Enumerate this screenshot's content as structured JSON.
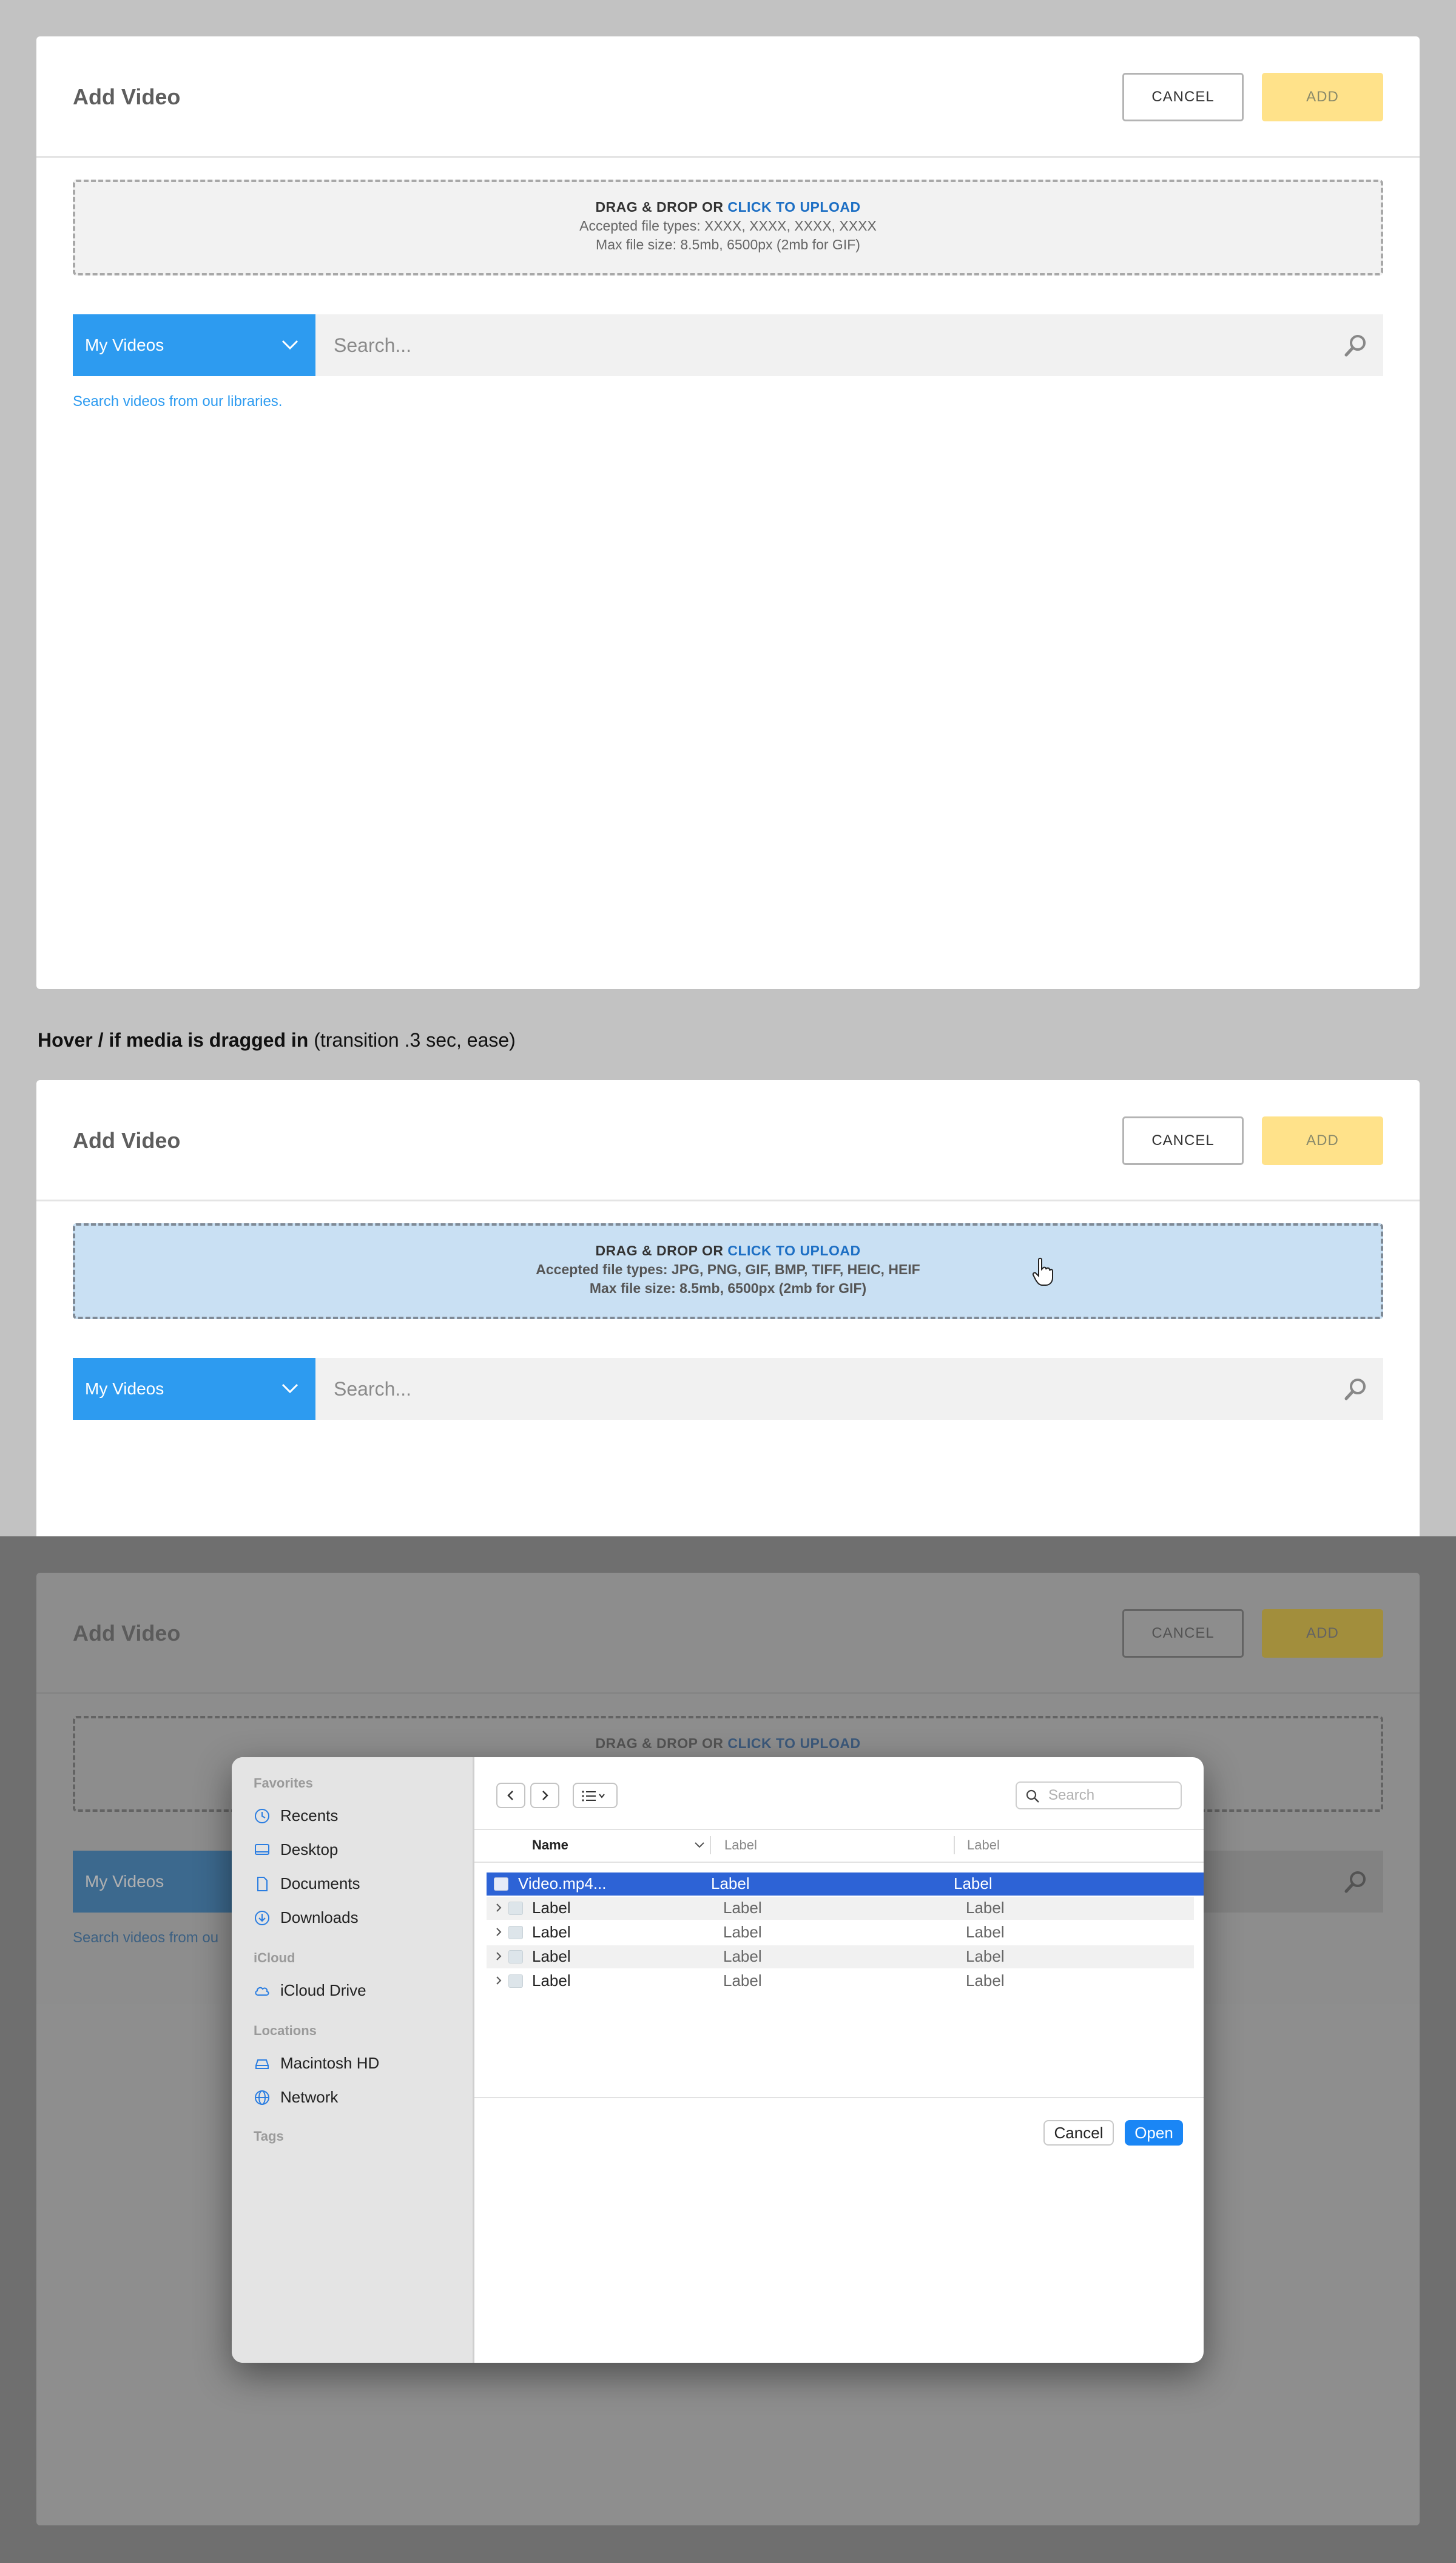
{
  "modal": {
    "title": "Add Video",
    "cancel_label": "CANCEL",
    "add_label": "ADD",
    "dropzone": {
      "prefix": "DRAG & DROP OR",
      "link": "CLICK TO UPLOAD",
      "accepted": "Accepted file types: XXXX, XXXX, XXXX, XXXX",
      "accepted_hover": "Accepted file types: JPG, PNG, GIF, BMP, TIFF, HEIC, HEIF",
      "max_size": "Max file size: 8.5mb, 6500px  (2mb for GIF)"
    },
    "library_select": "My Videos",
    "search_placeholder": "Search...",
    "helper_text": "Search videos from our libraries.",
    "helper_text_truncated": "Search videos from ou"
  },
  "annotation": {
    "bold": "Hover / if media is dragged in",
    "rest": " (transition .3 sec, ease)"
  },
  "file_dialog": {
    "sidebar": {
      "favorites_heading": "Favorites",
      "favorites": [
        {
          "label": "Recents",
          "icon": "clock-icon"
        },
        {
          "label": "Desktop",
          "icon": "desktop-icon"
        },
        {
          "label": "Documents",
          "icon": "document-icon"
        },
        {
          "label": "Downloads",
          "icon": "download-icon"
        }
      ],
      "icloud_heading": "iCloud",
      "icloud": [
        {
          "label": "iCloud Drive",
          "icon": "cloud-icon"
        }
      ],
      "locations_heading": "Locations",
      "locations": [
        {
          "label": "Macintosh HD",
          "icon": "drive-icon"
        },
        {
          "label": "Network",
          "icon": "globe-icon"
        }
      ],
      "tags_heading": "Tags"
    },
    "search_placeholder": "Search",
    "columns": [
      "Name",
      "Label",
      "Label"
    ],
    "rows": [
      {
        "name": "Video.mp4...",
        "c2": "Label",
        "c3": "Label",
        "selected": true
      },
      {
        "name": "Label",
        "c2": "Label",
        "c3": "Label"
      },
      {
        "name": "Label",
        "c2": "Label",
        "c3": "Label"
      },
      {
        "name": "Label",
        "c2": "Label",
        "c3": "Label"
      },
      {
        "name": "Label",
        "c2": "Label",
        "c3": "Label"
      }
    ],
    "cancel_label": "Cancel",
    "open_label": "Open"
  },
  "colors": {
    "accent_blue": "#2d9bf0",
    "add_button_disabled": "#ffe28a",
    "dropzone_hover": "#c9e0f3",
    "link_blue": "#1d6fc4",
    "dialog_selection": "#2d63d6",
    "dialog_open_button": "#1a86f5"
  }
}
